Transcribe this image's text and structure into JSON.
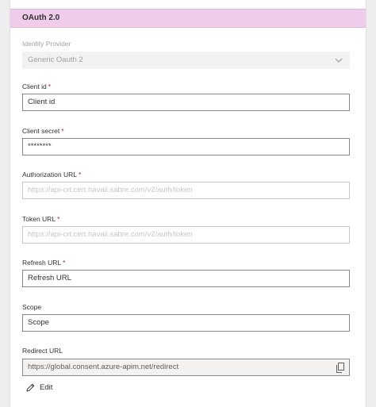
{
  "header": {
    "title": "OAuth 2.0"
  },
  "identity_provider": {
    "label": "Identity Provider",
    "value": "Generic Oauth 2"
  },
  "client_id": {
    "label": "Client id",
    "required_mark": "*",
    "value": "Client id"
  },
  "client_secret": {
    "label": "Client secret",
    "required_mark": "*",
    "value": "********"
  },
  "authorization_url": {
    "label": "Authorization URL",
    "required_mark": "*",
    "placeholder": "https://api-crt.cert.havail.sabre.com/v2/auth/token"
  },
  "token_url": {
    "label": "Token URL",
    "required_mark": "*",
    "placeholder": "https://api-crt.cert.havail.sabre.com/v2/auth/token"
  },
  "refresh_url": {
    "label": "Refresh URL",
    "required_mark": "*",
    "value": "Refresh URL"
  },
  "scope": {
    "label": "Scope",
    "value": "Scope"
  },
  "redirect_url": {
    "label": "Redirect URL",
    "value": "https://global.consent.azure-apim.net/redirect"
  },
  "edit": {
    "label": "Edit"
  },
  "icons": {
    "dropdown": "chevron-down-icon",
    "copy": "copy-icon",
    "edit": "pencil-icon"
  },
  "colors": {
    "header_bg": "#eeccea",
    "required": "#a4262c",
    "page_bg": "#eeeeee"
  }
}
